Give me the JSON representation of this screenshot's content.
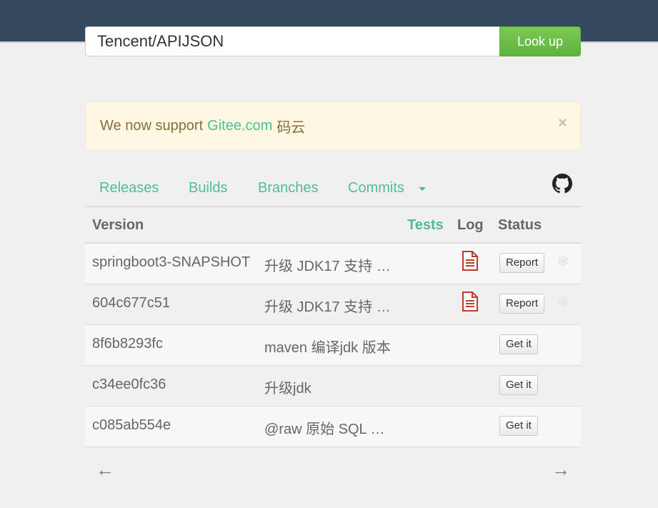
{
  "search": {
    "value": "Tencent/APIJSON",
    "button_label": "Look up"
  },
  "alert": {
    "prefix": "We now support",
    "link": "Gitee.com",
    "suffix": "码云",
    "close": "×"
  },
  "tabs": [
    {
      "label": "Releases"
    },
    {
      "label": "Builds"
    },
    {
      "label": "Branches"
    },
    {
      "label": "Commits"
    }
  ],
  "table": {
    "headers": {
      "version": "Version",
      "tests": "Tests",
      "log": "Log",
      "status": "Status"
    },
    "rows": [
      {
        "version": "springboot3-SNAPSHOT",
        "message": "升级 JDK17 支持 …",
        "has_log": true,
        "button": "Report",
        "snow": true
      },
      {
        "version": "604c677c51",
        "message": "升级 JDK17 支持 …",
        "has_log": true,
        "button": "Report",
        "snow": true
      },
      {
        "version": "8f6b8293fc",
        "message": "maven 编译jdk 版本",
        "has_log": false,
        "button": "Get it",
        "snow": false
      },
      {
        "version": "c34ee0fc36",
        "message": "升级jdk",
        "has_log": false,
        "button": "Get it",
        "snow": false
      },
      {
        "version": "c085ab554e",
        "message": "@raw 原始 SQL …",
        "has_log": false,
        "button": "Get it",
        "snow": false
      }
    ]
  },
  "pager": {
    "prev": "←",
    "next": "→"
  },
  "icons": {
    "github": "github-icon",
    "log": "document-icon",
    "status": "snowflake-icon"
  },
  "colors": {
    "accent": "#4fbf8f",
    "topbar": "#34495e",
    "lookup_button": "#6abd45",
    "alert_bg": "#fcf8e3",
    "log_icon": "#c0392b"
  }
}
